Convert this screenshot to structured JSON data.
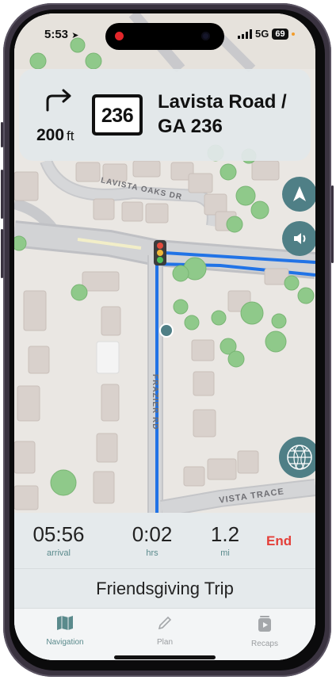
{
  "status_bar": {
    "time": "5:53",
    "network": "5G",
    "battery": "69"
  },
  "banner": {
    "distance_value": "200",
    "distance_unit": "ft",
    "route_shield": "236",
    "street_line1": "Lavista Road /",
    "street_line2": "GA 236",
    "turn_icon": "turn-right-arrow-icon"
  },
  "map": {
    "street_labels": [
      "LAVISTA OAKS DR",
      "FRAZIER RD",
      "VISTA TRACE"
    ],
    "route_color": "#2173e6",
    "recenter_icon": "navigation-arrow-icon",
    "audio_icon": "speaker-icon",
    "globe_icon": "globe-icon",
    "traffic_light_icon": "traffic-light-icon"
  },
  "trip_stats": {
    "arrival_value": "05:56",
    "arrival_label": "arrival",
    "duration_value": "0:02",
    "duration_label": "hrs",
    "distance_value": "1.2",
    "distance_label": "mi",
    "end_label": "End",
    "end_color": "#e4403a"
  },
  "trip_name": "Friendsgiving Trip",
  "tabs": [
    {
      "label": "Navigation",
      "icon": "map-icon",
      "active": true
    },
    {
      "label": "Plan",
      "icon": "pencil-icon",
      "active": false
    },
    {
      "label": "Recaps",
      "icon": "play-recap-icon",
      "active": false
    }
  ],
  "colors": {
    "accent": "#5a8a8c",
    "fab": "#4f7f86"
  }
}
